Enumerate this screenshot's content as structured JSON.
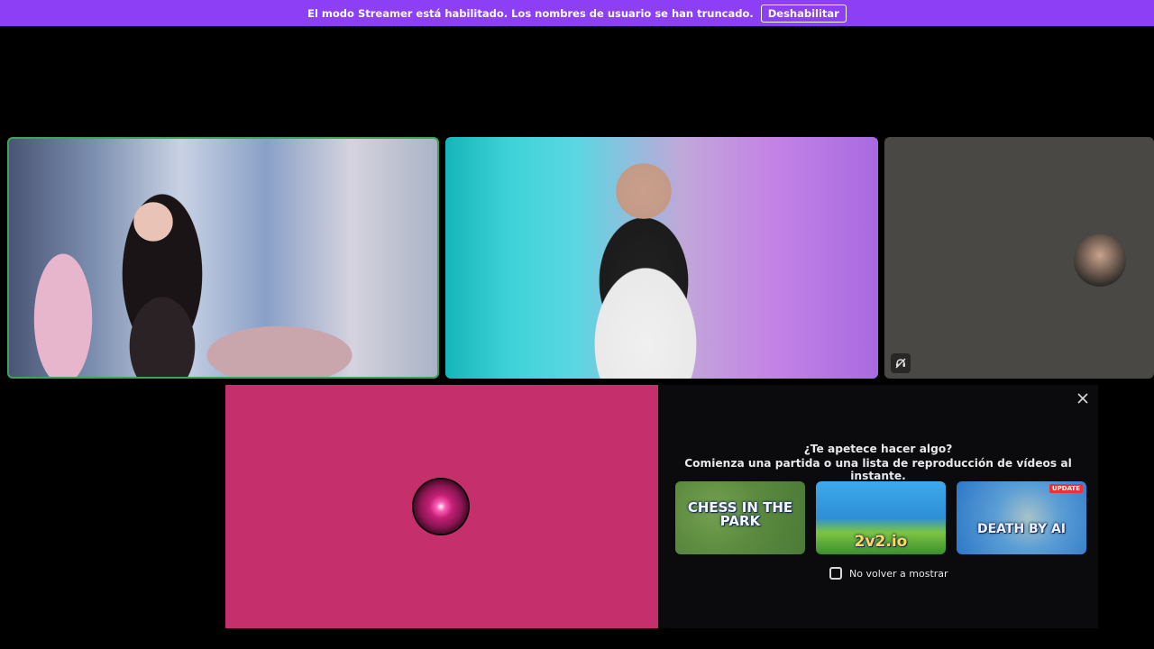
{
  "banner": {
    "message": "El modo Streamer está habilitado. Los nombres de usuario se han truncado.",
    "button_label": "Deshabilitar"
  },
  "call": {
    "tiles": [
      {
        "kind": "camera",
        "speaking": true
      },
      {
        "kind": "camera",
        "speaking": false
      },
      {
        "kind": "avatar",
        "muted_icon": "deafened-icon"
      }
    ]
  },
  "activities": {
    "title": "¿Te apetece hacer algo?",
    "subtitle": "Comienza una partida o una lista de reproducción de vídeos al instante.",
    "games": [
      {
        "label": "CHESS IN THE PARK",
        "badge": ""
      },
      {
        "label": "2v2.io",
        "badge": ""
      },
      {
        "label": "DEATH BY AI",
        "badge": "UPDATE"
      }
    ],
    "checkbox_label": "No volver a mostrar",
    "checkbox_checked": false
  },
  "colors": {
    "banner": "#8c3ff5",
    "speaking_border": "#3ba55d",
    "stream_background": "#c42f6c"
  }
}
